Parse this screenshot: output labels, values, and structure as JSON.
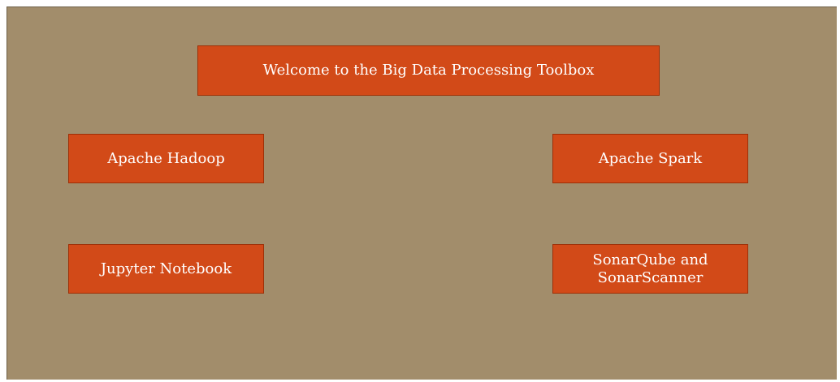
{
  "title": "Welcome to the Big Data Processing Toolbox",
  "tools": {
    "hadoop": "Apache Hadoop",
    "spark": "Apache Spark",
    "jupyter": "Jupyter Notebook",
    "sonar_line1": "SonarQube and",
    "sonar_line2": "SonarScanner"
  },
  "colors": {
    "background": "#a28d6b",
    "tile": "#d24a18",
    "text": "#ffffff"
  }
}
